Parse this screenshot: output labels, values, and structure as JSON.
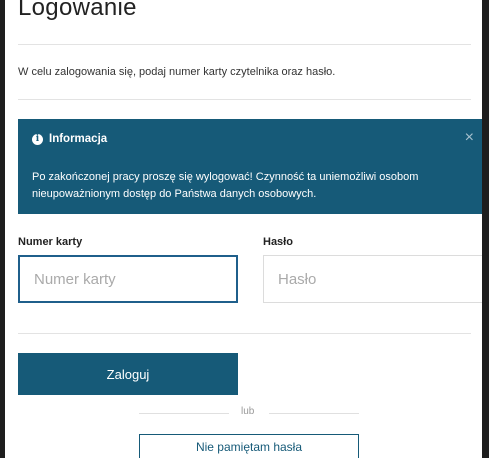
{
  "page": {
    "title": "Logowanie",
    "intro": "W celu zalogowania się, podaj numer karty czytelnika oraz hasło."
  },
  "alert": {
    "title": "Informacja",
    "icon": "info-icon",
    "close_icon": "close-icon",
    "message": "Po zakończonej pracy proszę się wylogować! Czynność ta uniemożliwi osobom nieupoważnionym dostęp do Państwa danych osobowych.",
    "background": "#165a78"
  },
  "form": {
    "card_label": "Numer karty",
    "card_placeholder": "Numer karty",
    "card_value": "",
    "password_label": "Hasło",
    "password_placeholder": "Hasło",
    "password_value": ""
  },
  "actions": {
    "login_label": "Zaloguj",
    "or_label": "lub",
    "forgot_label": "Nie pamiętam hasła"
  },
  "colors": {
    "accent": "#165a78",
    "focus_border": "#1f5f8b"
  }
}
